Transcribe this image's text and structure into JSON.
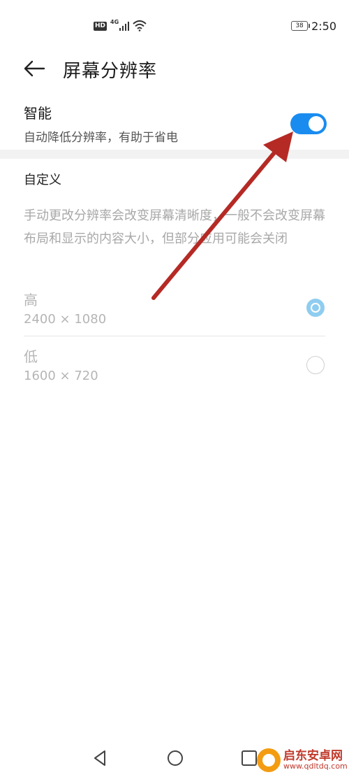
{
  "status_bar": {
    "hd": "HD",
    "network": "4G",
    "battery": "38",
    "time": "2:50"
  },
  "header": {
    "title": "屏幕分辨率"
  },
  "smart": {
    "title": "智能",
    "description": "自动降低分辨率，有助于省电",
    "enabled": true,
    "accent_color": "#1a8cf0"
  },
  "custom": {
    "title": "自定义",
    "description": "手动更改分辨率会改变屏幕清晰度，一般不会改变屏幕布局和显示的内容大小，但部分应用可能会关闭"
  },
  "options": [
    {
      "label": "高",
      "value": "2400 × 1080",
      "selected": true
    },
    {
      "label": "低",
      "value": "1600 × 720",
      "selected": false
    }
  ],
  "nav": {
    "icons": [
      "back-triangle-icon",
      "home-circle-icon",
      "recents-square-icon"
    ]
  },
  "watermark": {
    "name": "启东安卓网",
    "url": "www.qdltdq.com"
  },
  "annotation": {
    "arrow_color": "#b52a25"
  }
}
